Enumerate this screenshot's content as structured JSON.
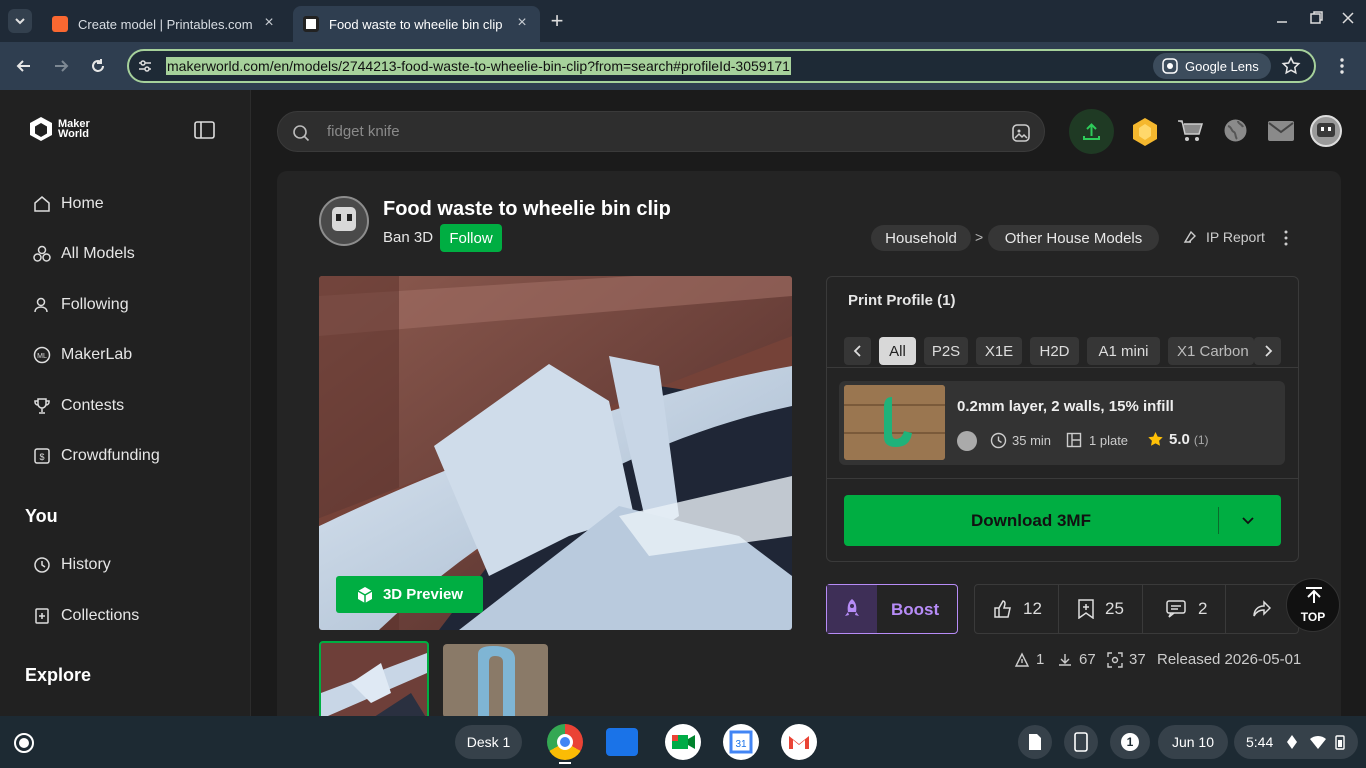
{
  "browser": {
    "tabs": [
      {
        "title": "Create model | Printables.com",
        "favicon_color": "#fa6831"
      },
      {
        "title": "Food waste to wheelie bin clip",
        "favicon_color": "#ffffff"
      }
    ],
    "url": "makerworld.com/en/models/2744213-food-waste-to-wheelie-bin-clip?from=search#profileId-3059171",
    "lens_label": "Google Lens"
  },
  "sidebar": {
    "logo": "Maker\nWorld",
    "items": [
      {
        "label": "Home",
        "icon": "home-icon"
      },
      {
        "label": "All Models",
        "icon": "models-icon"
      },
      {
        "label": "Following",
        "icon": "person-icon"
      },
      {
        "label": "MakerLab",
        "icon": "makerlab-icon"
      },
      {
        "label": "Contests",
        "icon": "trophy-icon"
      },
      {
        "label": "Crowdfunding",
        "icon": "crowdfunding-icon"
      }
    ],
    "you_heading": "You",
    "you_items": [
      {
        "label": "History",
        "icon": "history-icon"
      },
      {
        "label": "Collections",
        "icon": "collections-icon"
      }
    ],
    "explore_heading": "Explore"
  },
  "search": {
    "placeholder": "fidget knife"
  },
  "model": {
    "title": "Food waste to wheelie bin clip",
    "author": "Ban 3D",
    "follow_label": "Follow",
    "breadcrumb": [
      "Household",
      "Other House Models"
    ],
    "breadcrumb_sep": ">",
    "ip_report": "IP Report",
    "preview_label": "3D Preview"
  },
  "print_profile": {
    "heading": "Print Profile (1)",
    "filters": [
      "All",
      "P2S",
      "X1E",
      "H2D",
      "A1 mini",
      "X1 Carbon"
    ],
    "profile_name": "0.2mm layer, 2 walls, 15% infill",
    "time": "35 min",
    "plates": "1 plate",
    "rating": "5.0",
    "rating_count": "(1)",
    "download_label": "Download 3MF"
  },
  "actions": {
    "boost_label": "Boost",
    "likes": "12",
    "collects": "25",
    "comments": "2",
    "top_label": "TOP"
  },
  "meta": {
    "prints": "1",
    "downloads": "67",
    "views": "37",
    "released": "Released 2026-05-01"
  },
  "taskbar": {
    "desk_label": "Desk 1",
    "notification_count": "1",
    "date": "Jun 10",
    "time": "5:44"
  },
  "colors": {
    "accent_green": "#00ae42",
    "boost_purple": "#b78cf7",
    "star": "#ffc107"
  }
}
